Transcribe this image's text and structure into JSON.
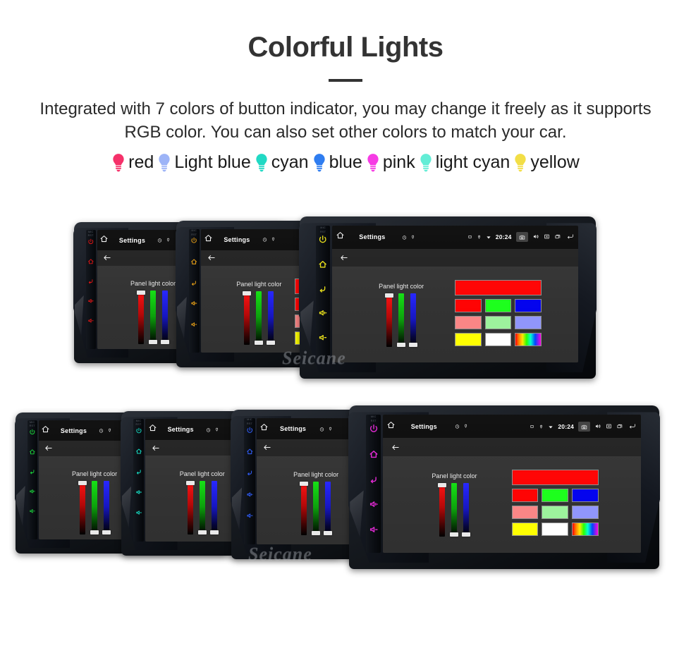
{
  "header": {
    "title": "Colorful Lights",
    "description": "Integrated with 7 colors of button indicator, you may change it freely as it supports RGB color. You can also set other colors to match your car."
  },
  "legend": {
    "items": [
      {
        "label": "red",
        "color": "#f5316a",
        "icon": "bulb-icon"
      },
      {
        "label": "Light blue",
        "color": "#9db4f7",
        "icon": "bulb-icon"
      },
      {
        "label": "cyan",
        "color": "#21d9c4",
        "icon": "bulb-icon"
      },
      {
        "label": "blue",
        "color": "#2f7df0",
        "icon": "bulb-icon"
      },
      {
        "label": "pink",
        "color": "#f63ce4",
        "icon": "bulb-icon"
      },
      {
        "label": "light cyan",
        "color": "#63edd6",
        "icon": "bulb-icon"
      },
      {
        "label": "yellow",
        "color": "#f2de46",
        "icon": "bulb-icon"
      }
    ]
  },
  "device_screen": {
    "status_bar": {
      "home_icon": "home-icon",
      "title": "Settings",
      "mini_icons": [
        "clock-icon",
        "pin-icon"
      ],
      "right_icons": [
        "alarm-icon",
        "location-icon",
        "wifi-icon"
      ],
      "time": "20:24",
      "camera_icon": "camera-icon",
      "volume_icon": "volume-icon",
      "close_icon": "close-box-icon",
      "recents_icon": "recents-icon",
      "back_icon": "back-arrow-icon"
    },
    "sub_bar": {
      "back_icon": "back-arrow-icon"
    },
    "panel": {
      "label": "Panel light color",
      "sliders": [
        {
          "name": "red-slider",
          "handle": "top",
          "value": 100
        },
        {
          "name": "green-slider",
          "handle": "bottom",
          "value": 0
        },
        {
          "name": "blue-slider",
          "handle": "bottom",
          "value": 0
        }
      ],
      "preview_color": "#ff0000",
      "swatches": [
        [
          "#ff0000",
          "#1aff1a",
          "#0000ee"
        ],
        [
          "#fa8585",
          "#9cf29c",
          "#8f95fb"
        ],
        [
          "#ffff00",
          "#ffffff",
          "rainbow"
        ]
      ]
    },
    "bezel": {
      "tags": [
        "MIC",
        "RST"
      ],
      "keys": [
        "power-icon",
        "home-icon",
        "back-icon",
        "volume-up-icon",
        "volume-down-icon"
      ]
    }
  },
  "watermark": {
    "text": "Seicane"
  },
  "rows": [
    {
      "name": "row-one",
      "units": [
        {
          "name": "unit-red",
          "key_color": "#e01515"
        },
        {
          "name": "unit-orange",
          "key_color": "#e8a016"
        },
        {
          "name": "unit-yellow",
          "key_color": "#e8df1b"
        }
      ]
    },
    {
      "name": "row-two",
      "units": [
        {
          "name": "unit-green",
          "key_color": "#19d23a"
        },
        {
          "name": "unit-cyan",
          "key_color": "#16dcc4"
        },
        {
          "name": "unit-blue",
          "key_color": "#2f5cf5"
        },
        {
          "name": "unit-magenta",
          "key_color": "#e52ad6"
        }
      ]
    }
  ]
}
